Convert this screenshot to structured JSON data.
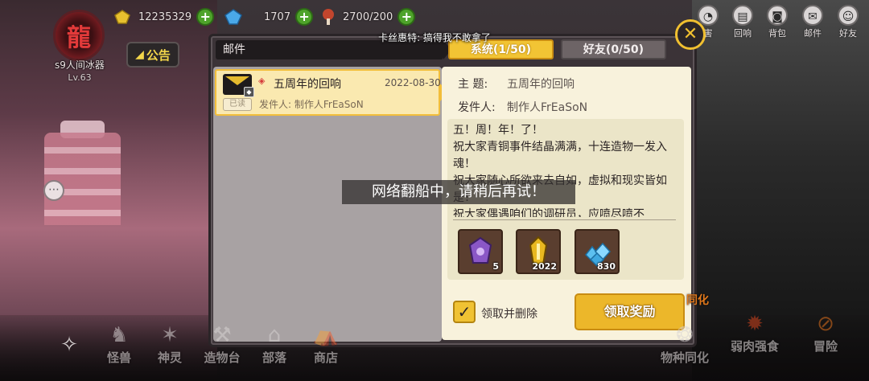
{
  "player": {
    "name": "s9人间冰器",
    "level": "Lv.63"
  },
  "resources": [
    {
      "icon": "gold-gem-icon",
      "value": "12235329"
    },
    {
      "icon": "blue-crystal-icon",
      "value": "1707"
    },
    {
      "icon": "meat-stamina-icon",
      "value": "2700/200"
    }
  ],
  "notice_button": "公告",
  "top_nav": [
    {
      "icon": "bulb-icon",
      "label": "害"
    },
    {
      "icon": "card-icon",
      "label": "回响"
    },
    {
      "icon": "bag-icon",
      "label": "背包"
    },
    {
      "icon": "mail-icon",
      "label": "邮件"
    },
    {
      "icon": "friends-icon",
      "label": "好友"
    }
  ],
  "modal": {
    "header": "邮件",
    "toast_top": "卡丝惠特: 搞得我不敢拿了",
    "tabs": {
      "system": "系统(1/50)",
      "friends": "好友(0/50)"
    },
    "close": "✕",
    "mail_list": [
      {
        "title": "五周年的回响",
        "date": "2022-08-30",
        "read_badge": "已读",
        "sender": "发件人: 制作人FrEaSoN"
      }
    ],
    "detail": {
      "subject_label": "主  题:",
      "subject": "五周年的回响",
      "sender_label": "发件人:",
      "sender": "制作人FrEaSoN",
      "content": "五！周！年！了！\n祝大家青铜事件结晶满满，十连造物一发入魂！\n祝大家随心所欲来去自如，虚拟和现实皆如是！\n祝大家偶遇咱们的调研员，应喷尽喷不",
      "rewards": [
        {
          "icon": "purple-crystal-icon",
          "count": "5"
        },
        {
          "icon": "gold-shard-icon",
          "count": "2022"
        },
        {
          "icon": "blue-diamond-pile-icon",
          "count": "830"
        }
      ],
      "checkbox_label": "领取并删除",
      "claim_button": "领取奖励"
    }
  },
  "toast_center": "网络翻船中，请稍后再试！",
  "species_tag": "同化",
  "bottom_nav_left": [
    "怪兽",
    "神灵",
    "造物台",
    "部落",
    "商店"
  ],
  "bottom_nav_right": [
    "物种同化",
    "弱肉强食",
    "冒险"
  ]
}
